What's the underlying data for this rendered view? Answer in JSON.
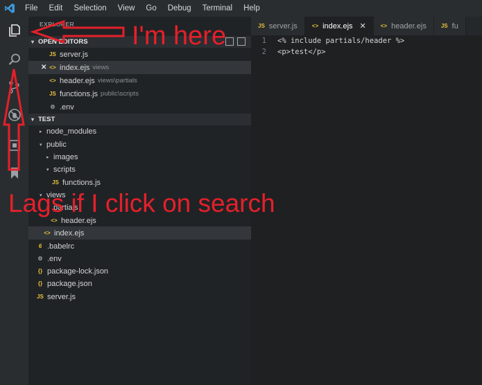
{
  "menu": [
    "File",
    "Edit",
    "Selection",
    "View",
    "Go",
    "Debug",
    "Terminal",
    "Help"
  ],
  "activity_icons": [
    "explorer-icon",
    "search-icon",
    "source-control-icon",
    "debug-icon",
    "extensions-icon",
    "bookmark-icon"
  ],
  "sidebar": {
    "title": "EXPLORER",
    "open_editors_label": "OPEN EDITORS",
    "open_editors": [
      {
        "icon": "JS",
        "name": "server.js",
        "desc": "",
        "close": ""
      },
      {
        "icon": "<>",
        "name": "index.ejs",
        "desc": "views",
        "close": "✕"
      },
      {
        "icon": "<>",
        "name": "header.ejs",
        "desc": "views\\partials",
        "close": ""
      },
      {
        "icon": "JS",
        "name": "functions.js",
        "desc": "public\\scripts",
        "close": ""
      },
      {
        "icon": "⚙",
        "name": ".env",
        "desc": "",
        "close": ""
      }
    ],
    "project_label": "TEST",
    "tree": [
      {
        "twistie": "▸",
        "icon": "",
        "name": "node_modules"
      },
      {
        "twistie": "▾",
        "icon": "",
        "name": "public"
      },
      {
        "twistie": "▸",
        "icon": "",
        "name": "images"
      },
      {
        "twistie": "▾",
        "icon": "",
        "name": "scripts"
      },
      {
        "twistie": "",
        "icon": "JS",
        "name": "functions.js"
      },
      {
        "twistie": "▾",
        "icon": "",
        "name": "views"
      },
      {
        "twistie": "▾",
        "icon": "",
        "name": "partials"
      },
      {
        "twistie": "",
        "icon": "<>",
        "name": "header.ejs"
      },
      {
        "twistie": "",
        "icon": "<>",
        "name": "index.ejs"
      },
      {
        "twistie": "",
        "icon": "6",
        "name": ".babelrc"
      },
      {
        "twistie": "",
        "icon": "⚙",
        "name": ".env"
      },
      {
        "twistie": "",
        "icon": "{}",
        "name": "package-lock.json"
      },
      {
        "twistie": "",
        "icon": "{}",
        "name": "package.json"
      },
      {
        "twistie": "",
        "icon": "JS",
        "name": "server.js"
      }
    ]
  },
  "tabs": [
    {
      "icon": "JS",
      "label": "server.js",
      "active": false
    },
    {
      "icon": "<>",
      "label": "index.ejs",
      "active": true
    },
    {
      "icon": "<>",
      "label": "header.ejs",
      "active": false
    },
    {
      "icon": "JS",
      "label": "fu",
      "active": false
    }
  ],
  "tab_close": "✕",
  "editor": {
    "lines": [
      {
        "num": "1",
        "text": "<% include partials/header %>"
      },
      {
        "num": "2",
        "text": "<p>test</p>"
      }
    ]
  },
  "annotations": {
    "here": "I'm here",
    "lags": "Lags if I click on search"
  },
  "colors": {
    "annotation": "#e5202a",
    "accent": "#e8c43a",
    "background": "#1e2022"
  }
}
